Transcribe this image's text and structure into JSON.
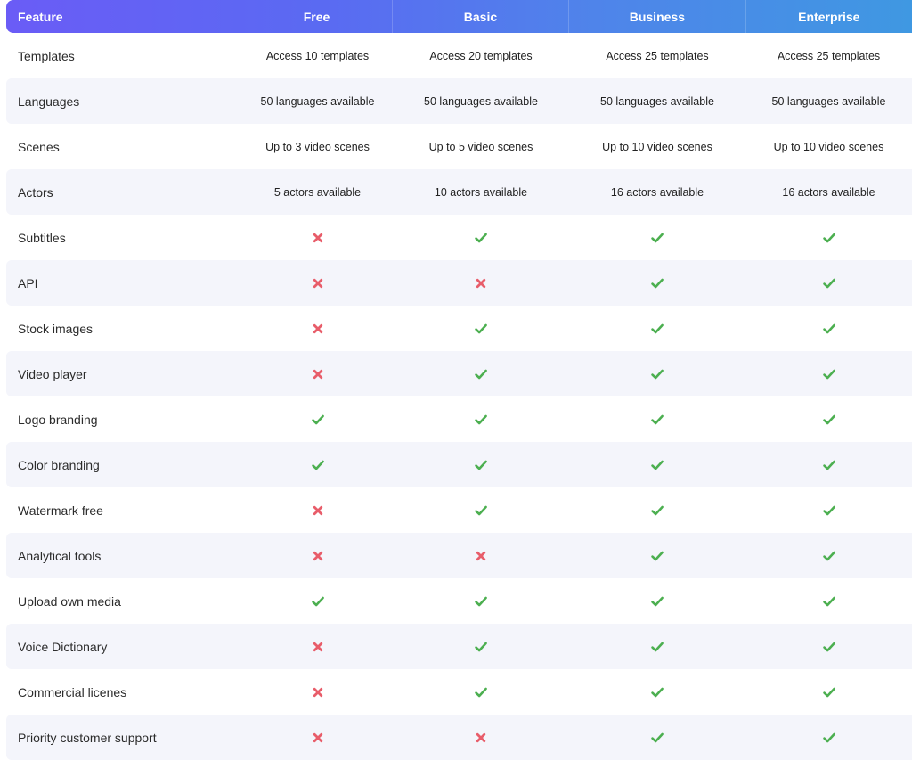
{
  "colors": {
    "check": "#4caf50",
    "cross": "#e85d6a"
  },
  "header": {
    "feature": "Feature",
    "plans": [
      "Free",
      "Basic",
      "Business",
      "Enterprise"
    ]
  },
  "rows": [
    {
      "feature": "Templates",
      "values": [
        "Access 10 templates",
        "Access 20 templates",
        "Access 25 templates",
        "Access 25 templates"
      ]
    },
    {
      "feature": "Languages",
      "values": [
        "50 languages available",
        "50 languages available",
        "50 languages available",
        "50 languages available"
      ]
    },
    {
      "feature": "Scenes",
      "values": [
        "Up to 3 video scenes",
        "Up to 5 video scenes",
        "Up to 10 video scenes",
        "Up to 10 video scenes"
      ]
    },
    {
      "feature": "Actors",
      "values": [
        "5 actors available",
        "10 actors available",
        "16 actors available",
        "16 actors available"
      ]
    },
    {
      "feature": "Subtitles",
      "values": [
        "cross",
        "check",
        "check",
        "check"
      ]
    },
    {
      "feature": "API",
      "values": [
        "cross",
        "cross",
        "check",
        "check"
      ]
    },
    {
      "feature": "Stock images",
      "values": [
        "cross",
        "check",
        "check",
        "check"
      ]
    },
    {
      "feature": "Video player",
      "values": [
        "cross",
        "check",
        "check",
        "check"
      ]
    },
    {
      "feature": "Logo branding",
      "values": [
        "check",
        "check",
        "check",
        "check"
      ]
    },
    {
      "feature": "Color branding",
      "values": [
        "check",
        "check",
        "check",
        "check"
      ]
    },
    {
      "feature": "Watermark free",
      "values": [
        "cross",
        "check",
        "check",
        "check"
      ]
    },
    {
      "feature": "Analytical tools",
      "values": [
        "cross",
        "cross",
        "check",
        "check"
      ]
    },
    {
      "feature": "Upload own media",
      "values": [
        "check",
        "check",
        "check",
        "check"
      ]
    },
    {
      "feature": "Voice Dictionary",
      "values": [
        "cross",
        "check",
        "check",
        "check"
      ]
    },
    {
      "feature": "Commercial licenes",
      "values": [
        "cross",
        "check",
        "check",
        "check"
      ]
    },
    {
      "feature": "Priority customer support",
      "values": [
        "cross",
        "cross",
        "check",
        "check"
      ]
    }
  ]
}
